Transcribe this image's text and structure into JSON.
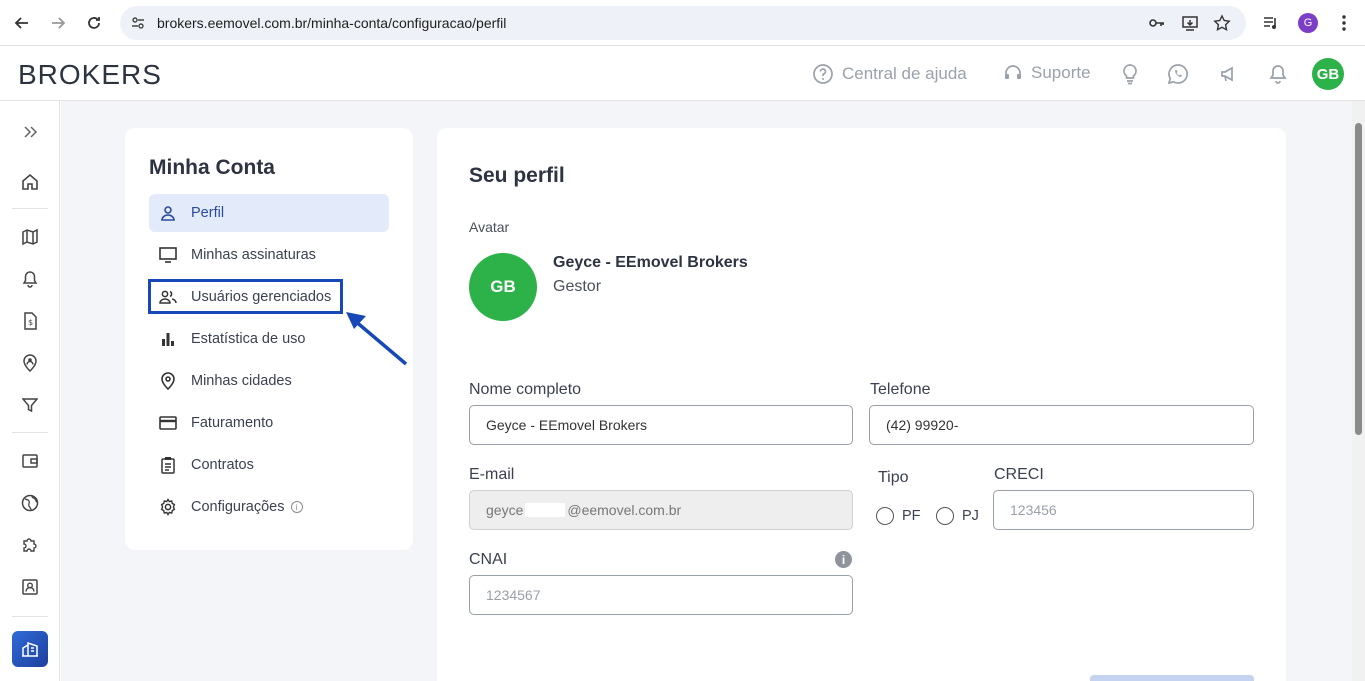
{
  "browser": {
    "url": "brokers.eemovel.com.br/minha-conta/configuracao/perfil",
    "profile_initial": "G"
  },
  "header": {
    "logo": "BROKERS",
    "help_label": "Central de ajuda",
    "support_label": "Suporte",
    "avatar_initials": "GB"
  },
  "menu": {
    "title": "Minha Conta",
    "items": [
      {
        "label": "Perfil",
        "icon": "person-icon"
      },
      {
        "label": "Minhas assinaturas",
        "icon": "monitor-icon"
      },
      {
        "label": "Usuários gerenciados",
        "icon": "group-icon"
      },
      {
        "label": "Estatística de uso",
        "icon": "bar-chart-icon"
      },
      {
        "label": "Minhas cidades",
        "icon": "location-pin-icon"
      },
      {
        "label": "Faturamento",
        "icon": "credit-card-icon"
      },
      {
        "label": "Contratos",
        "icon": "clipboard-icon"
      },
      {
        "label": "Configurações",
        "icon": "gear-icon"
      }
    ]
  },
  "profile": {
    "title": "Seu perfil",
    "avatar_label": "Avatar",
    "avatar_initials": "GB",
    "name": "Geyce - EEmovel Brokers",
    "role": "Gestor"
  },
  "form": {
    "nome_label": "Nome completo",
    "nome_value": "Geyce - EEmovel Brokers",
    "telefone_label": "Telefone",
    "telefone_value": "(42) 99920-",
    "email_label": "E-mail",
    "email_prefix": "geyce",
    "email_suffix": "@eemovel.com.br",
    "tipo_label": "Tipo",
    "tipo_options": [
      "PF",
      "PJ"
    ],
    "creci_label": "CRECI",
    "creci_placeholder": "123456",
    "cnai_label": "CNAI",
    "cnai_placeholder": "1234567"
  },
  "colors": {
    "accent": "#2b4c9a",
    "avatar_green": "#2db24a",
    "highlight": "#1648b8"
  }
}
